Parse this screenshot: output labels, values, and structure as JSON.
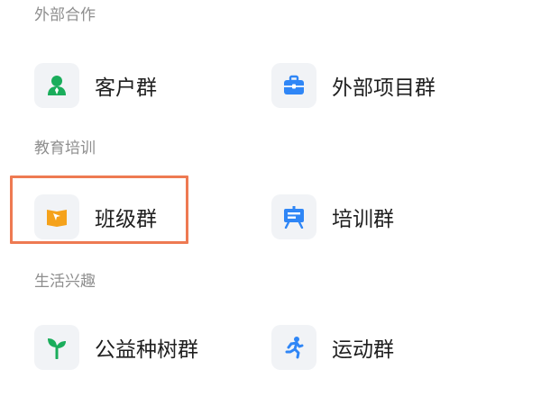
{
  "sections": [
    {
      "title": "外部合作",
      "items": [
        {
          "label": "客户群",
          "icon": "person-icon",
          "color": "#1aad5b"
        },
        {
          "label": "外部项目群",
          "icon": "briefcase-icon",
          "color": "#2f86f6"
        }
      ]
    },
    {
      "title": "教育培训",
      "items": [
        {
          "label": "班级群",
          "icon": "book-icon",
          "color": "#f5a21b"
        },
        {
          "label": "培训群",
          "icon": "presentation-board-icon",
          "color": "#2f86f6"
        }
      ]
    },
    {
      "title": "生活兴趣",
      "items": [
        {
          "label": "公益种树群",
          "icon": "sprout-icon",
          "color": "#1aad5b"
        },
        {
          "label": "运动群",
          "icon": "running-icon",
          "color": "#2f86f6"
        }
      ]
    }
  ],
  "highlight_color": "#ee7a52"
}
